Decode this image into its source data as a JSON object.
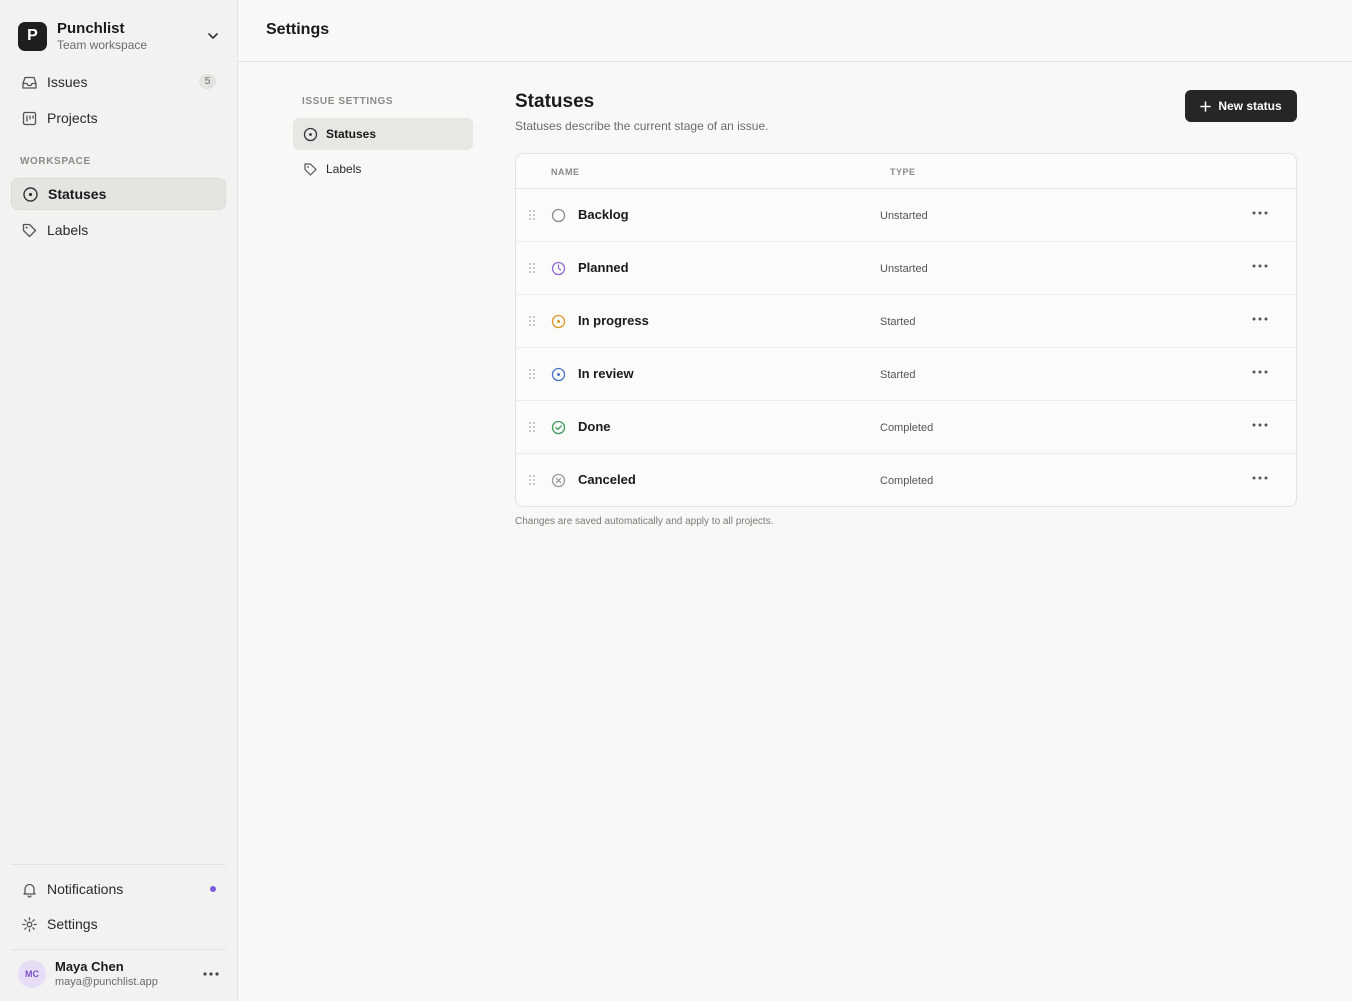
{
  "workspace": {
    "logo_letter": "P",
    "name": "Punchlist",
    "subtitle": "Team workspace"
  },
  "sidebar": {
    "primary": [
      {
        "label": "Issues",
        "icon": "inbox-icon",
        "badge": "5"
      },
      {
        "label": "Projects",
        "icon": "projects-icon"
      }
    ],
    "section_label": "WORKSPACE",
    "workspace_items": [
      {
        "label": "Statuses",
        "icon": "status-icon",
        "active": true
      },
      {
        "label": "Labels",
        "icon": "tag-icon"
      }
    ],
    "bottom": [
      {
        "label": "Notifications",
        "icon": "bell-icon",
        "dot_color": "#7b5ce0"
      },
      {
        "label": "Settings",
        "icon": "gear-icon"
      }
    ],
    "user": {
      "initials": "MC",
      "name": "Maya Chen",
      "email": "maya@punchlist.app"
    }
  },
  "header": {
    "title": "Settings"
  },
  "subnav": {
    "label": "ISSUE SETTINGS",
    "items": [
      {
        "label": "Statuses",
        "icon": "status-icon",
        "active": true
      },
      {
        "label": "Labels",
        "icon": "tag-icon"
      }
    ]
  },
  "content": {
    "title": "Statuses",
    "description": "Statuses describe the current stage of an issue.",
    "new_button": "New status",
    "columns": {
      "name": "NAME",
      "type": "TYPE"
    },
    "rows": [
      {
        "name": "Backlog",
        "type": "Unstarted",
        "icon": "backlog-icon",
        "color": "#8a8a86"
      },
      {
        "name": "Planned",
        "type": "Unstarted",
        "icon": "planned-icon",
        "color": "#8e6bd6"
      },
      {
        "name": "In progress",
        "type": "Started",
        "icon": "in-progress-icon",
        "color": "#d9972a"
      },
      {
        "name": "In review",
        "type": "Started",
        "icon": "in-review-icon",
        "color": "#4a72c4"
      },
      {
        "name": "Done",
        "type": "Completed",
        "icon": "done-icon",
        "color": "#3d9a5b"
      },
      {
        "name": "Canceled",
        "type": "Completed",
        "icon": "canceled-icon",
        "color": "#9a9a96"
      }
    ],
    "footnote": "Changes are saved automatically and apply to all projects."
  }
}
